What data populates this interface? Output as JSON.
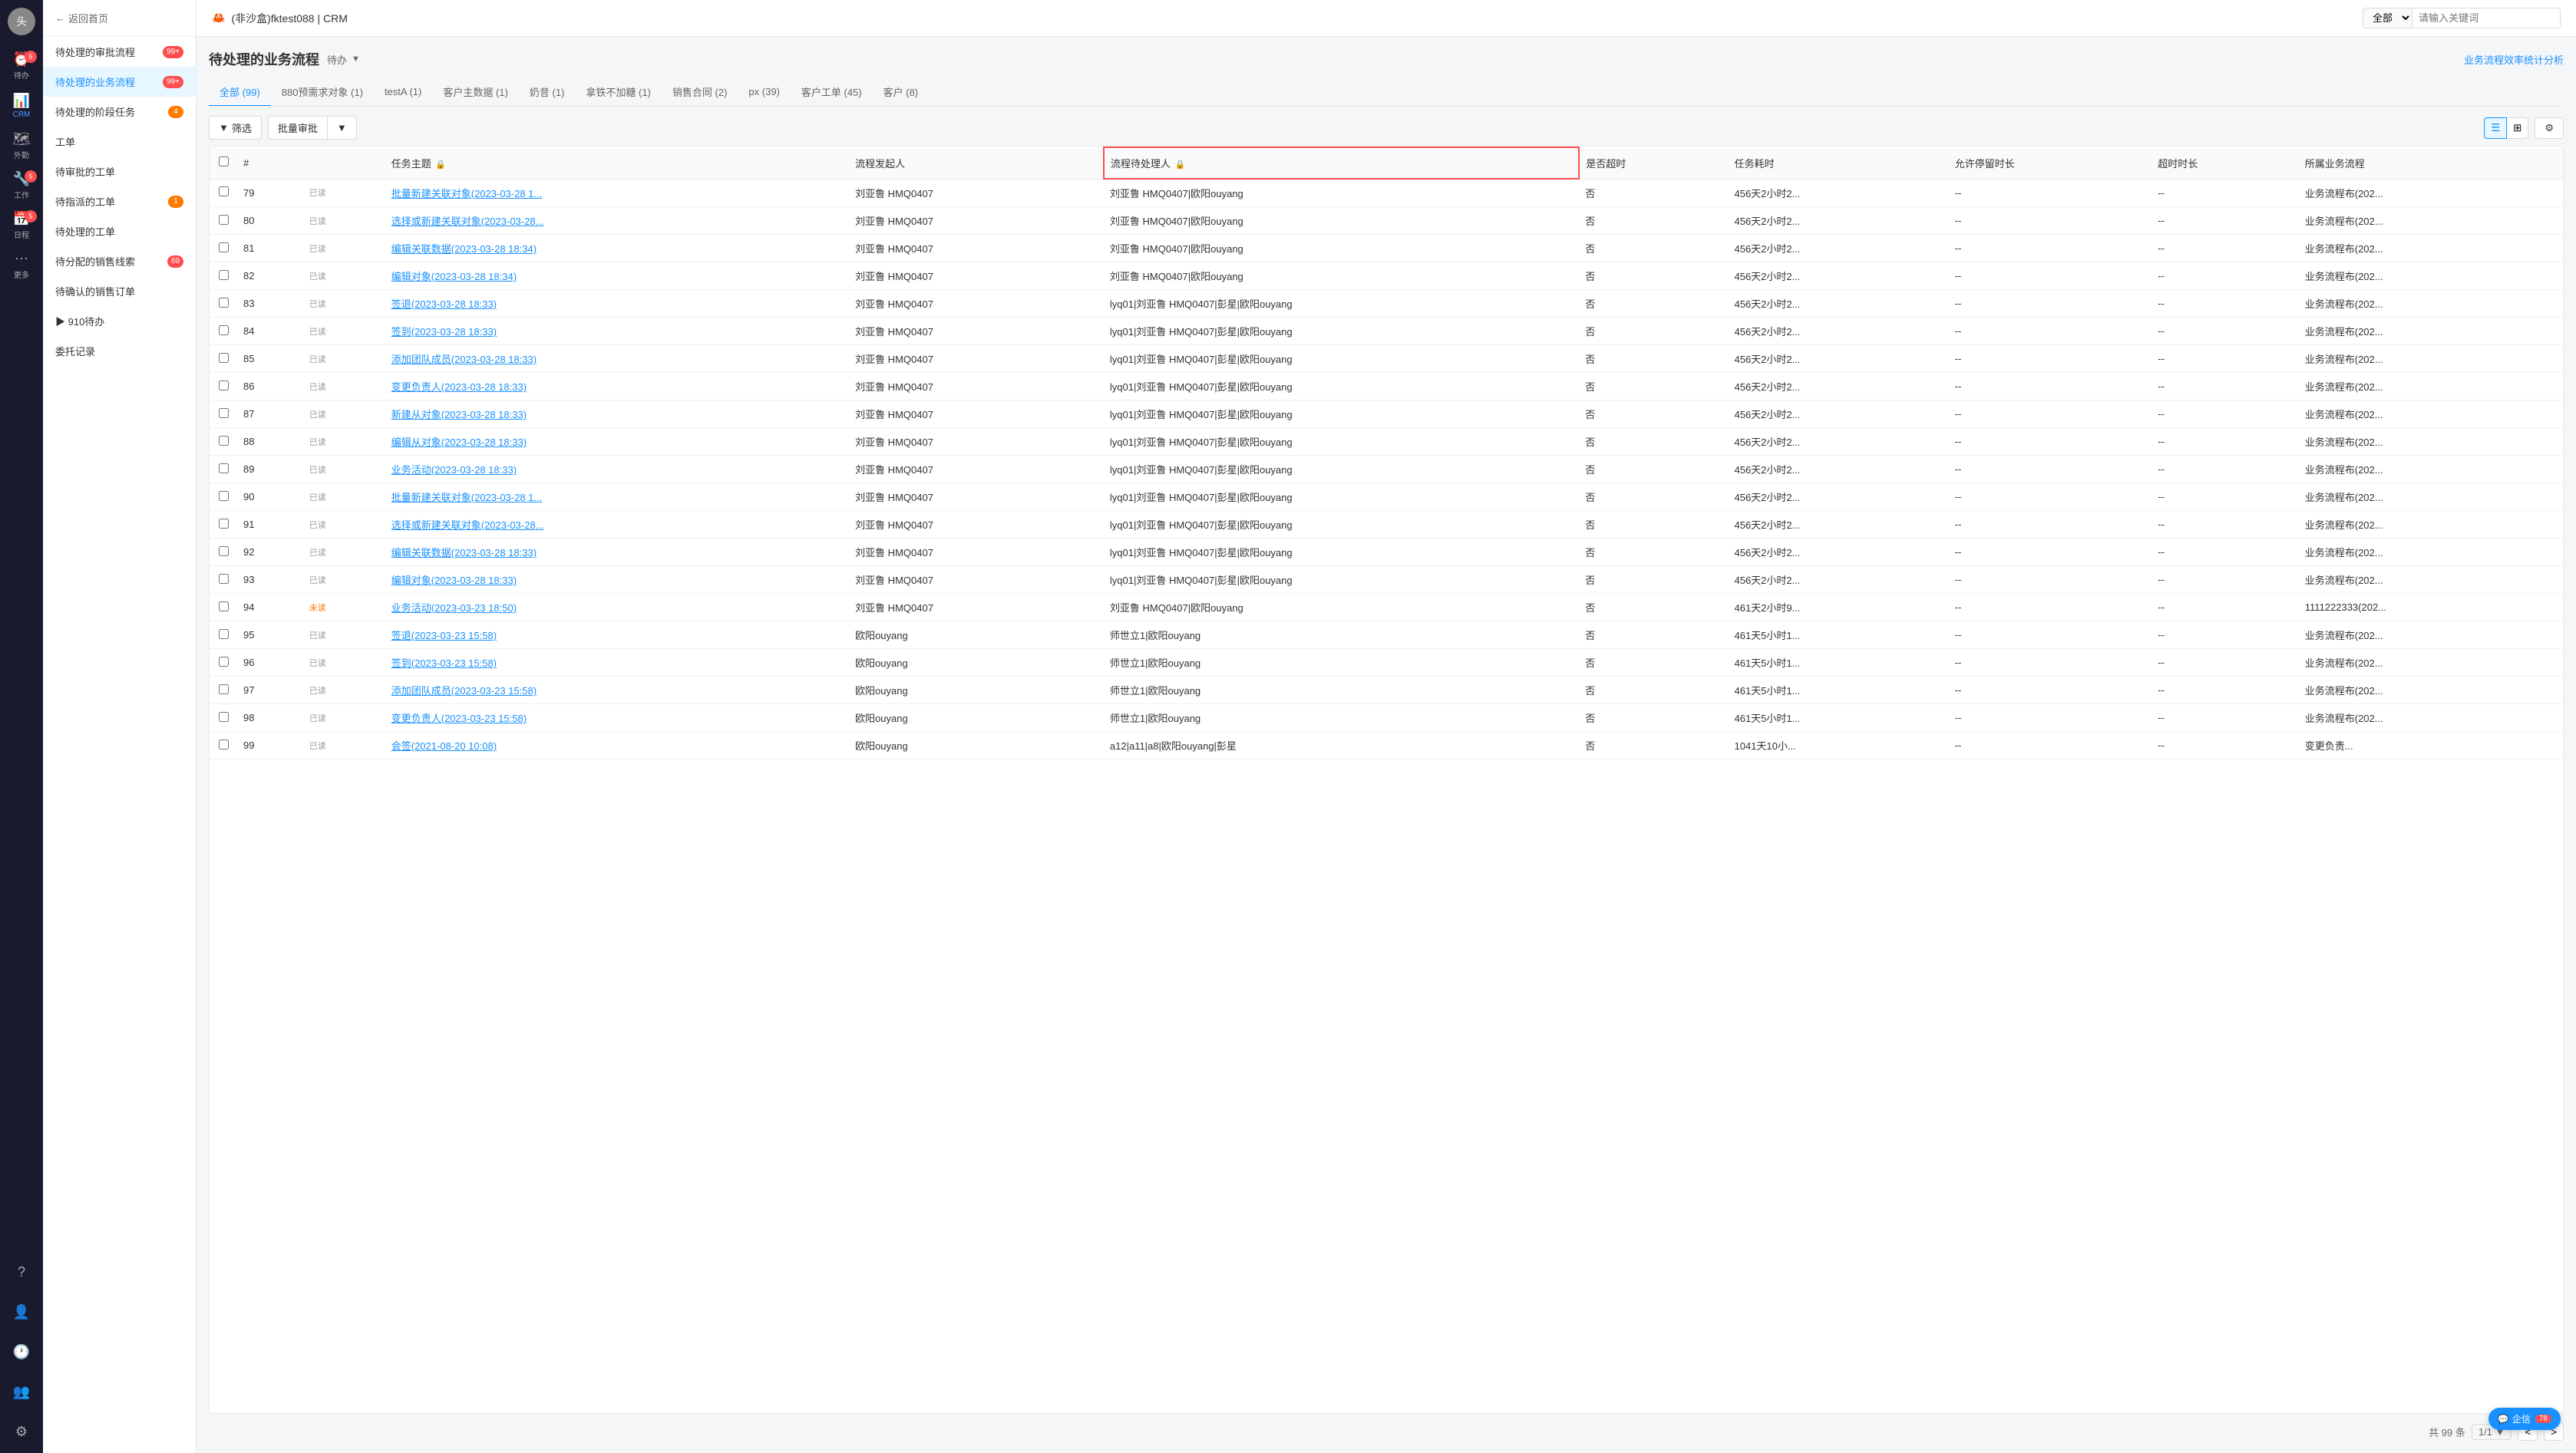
{
  "app": {
    "title": "(非沙盒)fktest088 | CRM",
    "logo": "🦀"
  },
  "topbar": {
    "search_placeholder": "请输入关键词",
    "search_option": "全部",
    "link": "业务流程效率统计分析"
  },
  "nav": {
    "avatar_text": "头",
    "items": [
      {
        "id": "todo",
        "icon": "⏰",
        "label": "待办",
        "badge": "5",
        "active": false
      },
      {
        "id": "crm",
        "icon": "📊",
        "label": "CRM",
        "badge": "",
        "active": true
      },
      {
        "id": "field",
        "icon": "🗺",
        "label": "外勤",
        "badge": "",
        "active": false
      },
      {
        "id": "work",
        "icon": "🔧",
        "label": "工作",
        "badge": "5",
        "active": false
      },
      {
        "id": "schedule",
        "icon": "📅",
        "label": "日程",
        "badge": "5",
        "active": false
      },
      {
        "id": "more",
        "icon": "⋯",
        "label": "更多",
        "badge": "",
        "active": false
      },
      {
        "id": "help",
        "icon": "?",
        "label": "",
        "badge": "",
        "active": false
      },
      {
        "id": "contacts",
        "icon": "👤",
        "label": "",
        "badge": "",
        "active": false
      },
      {
        "id": "history",
        "icon": "🕐",
        "label": "",
        "badge": "",
        "active": false
      },
      {
        "id": "team",
        "icon": "👥",
        "label": "",
        "badge": "",
        "active": false
      },
      {
        "id": "settings",
        "icon": "⚙",
        "label": "",
        "badge": "",
        "active": false
      }
    ]
  },
  "sidebar": {
    "back_label": "返回首页",
    "items": [
      {
        "id": "approval-flow",
        "label": "待处理的审批流程",
        "badge": "99+",
        "badge_type": "red",
        "active": false
      },
      {
        "id": "business-flow",
        "label": "待处理的业务流程",
        "badge": "99+",
        "badge_type": "red",
        "active": true
      },
      {
        "id": "stage-task",
        "label": "待处理的阶段任务",
        "badge": "4",
        "badge_type": "orange",
        "active": false
      },
      {
        "id": "workorder",
        "label": "工单",
        "badge": "",
        "badge_type": "",
        "active": false
      },
      {
        "id": "pending-approval",
        "label": "待审批的工单",
        "badge": "",
        "badge_type": "",
        "active": false
      },
      {
        "id": "assigned-workorder",
        "label": "待指派的工单",
        "badge": "1",
        "badge_type": "orange",
        "active": false
      },
      {
        "id": "pending-workorder",
        "label": "待处理的工单",
        "badge": "",
        "badge_type": "",
        "active": false
      },
      {
        "id": "pending-sales-leads",
        "label": "待分配的销售线索",
        "badge": "69",
        "badge_type": "red",
        "active": false
      },
      {
        "id": "pending-sales-order",
        "label": "待确认的销售订单",
        "badge": "",
        "badge_type": "",
        "active": false
      },
      {
        "id": "group-910",
        "label": "▶ 910待办",
        "badge": "",
        "badge_type": "",
        "active": false
      },
      {
        "id": "delegate",
        "label": "委托记录",
        "badge": "",
        "badge_type": "",
        "active": false
      }
    ]
  },
  "page": {
    "title": "待处理的业务流程",
    "status": "待办",
    "tabs": [
      {
        "id": "all",
        "label": "全部 (99)",
        "active": true
      },
      {
        "id": "880",
        "label": "880预需求对象 (1)",
        "active": false
      },
      {
        "id": "testA",
        "label": "testA (1)",
        "active": false
      },
      {
        "id": "customer-master",
        "label": "客户主数据 (1)",
        "active": false
      },
      {
        "id": "naitang",
        "label": "奶昔 (1)",
        "active": false
      },
      {
        "id": "gatiebutang",
        "label": "拿铁不加糖 (1)",
        "active": false
      },
      {
        "id": "sales-contract",
        "label": "销售合同 (2)",
        "active": false
      },
      {
        "id": "px",
        "label": "px (39)",
        "active": false
      },
      {
        "id": "customer-workorder",
        "label": "客户工单 (45)",
        "active": false
      },
      {
        "id": "customer",
        "label": "客户 (8)",
        "active": false
      }
    ]
  },
  "toolbar": {
    "filter_label": "筛选",
    "batch_label": "批量审批",
    "view_list_label": "列表视图",
    "view_grid_label": "网格视图",
    "settings_label": "设置"
  },
  "table": {
    "columns": [
      {
        "id": "num",
        "label": "#"
      },
      {
        "id": "eye",
        "label": ""
      },
      {
        "id": "subject",
        "label": "任务主题",
        "locked": true
      },
      {
        "id": "initiator",
        "label": "流程发起人"
      },
      {
        "id": "handler",
        "label": "流程待处理人",
        "locked": true,
        "highlighted": true
      },
      {
        "id": "overtime",
        "label": "是否超时"
      },
      {
        "id": "duration",
        "label": "任务耗时"
      },
      {
        "id": "allowed_pause",
        "label": "允许停留时长"
      },
      {
        "id": "overtime_duration",
        "label": "超时时长"
      },
      {
        "id": "flow_name",
        "label": "所属业务流程"
      }
    ],
    "rows": [
      {
        "num": 79,
        "read": "已读",
        "subject": "批量新建关联对象(2023-03-28 1...",
        "initiator": "刘亚鲁 HMQ0407",
        "handler": "刘亚鲁 HMQ0407|欧阳ouyang",
        "overtime": "否",
        "duration": "456天2小时2...",
        "allowed_pause": "--",
        "overtime_duration": "--",
        "flow_name": "业务流程布(202..."
      },
      {
        "num": 80,
        "read": "已读",
        "subject": "选择或新建关联对象(2023-03-28...",
        "initiator": "刘亚鲁 HMQ0407",
        "handler": "刘亚鲁 HMQ0407|欧阳ouyang",
        "overtime": "否",
        "duration": "456天2小时2...",
        "allowed_pause": "--",
        "overtime_duration": "--",
        "flow_name": "业务流程布(202..."
      },
      {
        "num": 81,
        "read": "已读",
        "subject": "编辑关联数据(2023-03-28 18:34)",
        "initiator": "刘亚鲁 HMQ0407",
        "handler": "刘亚鲁 HMQ0407|欧阳ouyang",
        "overtime": "否",
        "duration": "456天2小时2...",
        "allowed_pause": "--",
        "overtime_duration": "--",
        "flow_name": "业务流程布(202..."
      },
      {
        "num": 82,
        "read": "已读",
        "subject": "编辑对象(2023-03-28 18:34)",
        "initiator": "刘亚鲁 HMQ0407",
        "handler": "刘亚鲁 HMQ0407|欧阳ouyang",
        "overtime": "否",
        "duration": "456天2小时2...",
        "allowed_pause": "--",
        "overtime_duration": "--",
        "flow_name": "业务流程布(202..."
      },
      {
        "num": 83,
        "read": "已读",
        "subject": "签退(2023-03-28 18:33)",
        "initiator": "刘亚鲁 HMQ0407",
        "handler": "lyq01|刘亚鲁 HMQ0407|彭星|欧阳ouyang",
        "overtime": "否",
        "duration": "456天2小时2...",
        "allowed_pause": "--",
        "overtime_duration": "--",
        "flow_name": "业务流程布(202..."
      },
      {
        "num": 84,
        "read": "已读",
        "subject": "签到(2023-03-28 18:33)",
        "initiator": "刘亚鲁 HMQ0407",
        "handler": "lyq01|刘亚鲁 HMQ0407|彭星|欧阳ouyang",
        "overtime": "否",
        "duration": "456天2小时2...",
        "allowed_pause": "--",
        "overtime_duration": "--",
        "flow_name": "业务流程布(202..."
      },
      {
        "num": 85,
        "read": "已读",
        "subject": "添加团队成员(2023-03-28 18:33)",
        "initiator": "刘亚鲁 HMQ0407",
        "handler": "lyq01|刘亚鲁 HMQ0407|彭星|欧阳ouyang",
        "overtime": "否",
        "duration": "456天2小时2...",
        "allowed_pause": "--",
        "overtime_duration": "--",
        "flow_name": "业务流程布(202..."
      },
      {
        "num": 86,
        "read": "已读",
        "subject": "变更负责人(2023-03-28 18:33)",
        "initiator": "刘亚鲁 HMQ0407",
        "handler": "lyq01|刘亚鲁 HMQ0407|彭星|欧阳ouyang",
        "overtime": "否",
        "duration": "456天2小时2...",
        "allowed_pause": "--",
        "overtime_duration": "--",
        "flow_name": "业务流程布(202..."
      },
      {
        "num": 87,
        "read": "已读",
        "subject": "新建从对象(2023-03-28 18:33)",
        "initiator": "刘亚鲁 HMQ0407",
        "handler": "lyq01|刘亚鲁 HMQ0407|彭星|欧阳ouyang",
        "overtime": "否",
        "duration": "456天2小时2...",
        "allowed_pause": "--",
        "overtime_duration": "--",
        "flow_name": "业务流程布(202..."
      },
      {
        "num": 88,
        "read": "已读",
        "subject": "编辑从对象(2023-03-28 18:33)",
        "initiator": "刘亚鲁 HMQ0407",
        "handler": "lyq01|刘亚鲁 HMQ0407|彭星|欧阳ouyang",
        "overtime": "否",
        "duration": "456天2小时2...",
        "allowed_pause": "--",
        "overtime_duration": "--",
        "flow_name": "业务流程布(202..."
      },
      {
        "num": 89,
        "read": "已读",
        "subject": "业务活动(2023-03-28 18:33)",
        "initiator": "刘亚鲁 HMQ0407",
        "handler": "lyq01|刘亚鲁 HMQ0407|彭星|欧阳ouyang",
        "overtime": "否",
        "duration": "456天2小时2...",
        "allowed_pause": "--",
        "overtime_duration": "--",
        "flow_name": "业务流程布(202..."
      },
      {
        "num": 90,
        "read": "已读",
        "subject": "批量新建关联对象(2023-03-28 1...",
        "initiator": "刘亚鲁 HMQ0407",
        "handler": "lyq01|刘亚鲁 HMQ0407|彭星|欧阳ouyang",
        "overtime": "否",
        "duration": "456天2小时2...",
        "allowed_pause": "--",
        "overtime_duration": "--",
        "flow_name": "业务流程布(202..."
      },
      {
        "num": 91,
        "read": "已读",
        "subject": "选择或新建关联对象(2023-03-28...",
        "initiator": "刘亚鲁 HMQ0407",
        "handler": "lyq01|刘亚鲁 HMQ0407|彭星|欧阳ouyang",
        "overtime": "否",
        "duration": "456天2小时2...",
        "allowed_pause": "--",
        "overtime_duration": "--",
        "flow_name": "业务流程布(202..."
      },
      {
        "num": 92,
        "read": "已读",
        "subject": "编辑关联数据(2023-03-28 18:33)",
        "initiator": "刘亚鲁 HMQ0407",
        "handler": "lyq01|刘亚鲁 HMQ0407|彭星|欧阳ouyang",
        "overtime": "否",
        "duration": "456天2小时2...",
        "allowed_pause": "--",
        "overtime_duration": "--",
        "flow_name": "业务流程布(202..."
      },
      {
        "num": 93,
        "read": "已读",
        "subject": "编辑对象(2023-03-28 18:33)",
        "initiator": "刘亚鲁 HMQ0407",
        "handler": "lyq01|刘亚鲁 HMQ0407|彭星|欧阳ouyang",
        "overtime": "否",
        "duration": "456天2小时2...",
        "allowed_pause": "--",
        "overtime_duration": "--",
        "flow_name": "业务流程布(202..."
      },
      {
        "num": 94,
        "read": "未读",
        "subject": "业务活动(2023-03-23 18:50)",
        "initiator": "刘亚鲁 HMQ0407",
        "handler": "刘亚鲁 HMQ0407|欧阳ouyang",
        "overtime": "否",
        "duration": "461天2小时9...",
        "allowed_pause": "--",
        "overtime_duration": "--",
        "flow_name": "1111222333(202..."
      },
      {
        "num": 95,
        "read": "已读",
        "subject": "签退(2023-03-23 15:58)",
        "initiator": "欧阳ouyang",
        "handler": "师世立1|欧阳ouyang",
        "overtime": "否",
        "duration": "461天5小时1...",
        "allowed_pause": "--",
        "overtime_duration": "--",
        "flow_name": "业务流程布(202..."
      },
      {
        "num": 96,
        "read": "已读",
        "subject": "签到(2023-03-23 15:58)",
        "initiator": "欧阳ouyang",
        "handler": "师世立1|欧阳ouyang",
        "overtime": "否",
        "duration": "461天5小时1...",
        "allowed_pause": "--",
        "overtime_duration": "--",
        "flow_name": "业务流程布(202..."
      },
      {
        "num": 97,
        "read": "已读",
        "subject": "添加团队成员(2023-03-23 15:58)",
        "initiator": "欧阳ouyang",
        "handler": "师世立1|欧阳ouyang",
        "overtime": "否",
        "duration": "461天5小时1...",
        "allowed_pause": "--",
        "overtime_duration": "--",
        "flow_name": "业务流程布(202..."
      },
      {
        "num": 98,
        "read": "已读",
        "subject": "变更负责人(2023-03-23 15:58)",
        "initiator": "欧阳ouyang",
        "handler": "师世立1|欧阳ouyang",
        "overtime": "否",
        "duration": "461天5小时1...",
        "allowed_pause": "--",
        "overtime_duration": "--",
        "flow_name": "业务流程布(202..."
      },
      {
        "num": 99,
        "read": "已读",
        "subject": "会签(2021-08-20 10:08)",
        "initiator": "欧阳ouyang",
        "handler": "a12|a11|a8|欧阳ouyang|彭星",
        "overtime": "否",
        "duration": "1041天10小...",
        "allowed_pause": "--",
        "overtime_duration": "--",
        "flow_name": "变更负责..."
      }
    ]
  },
  "pagination": {
    "total": "共 99 条",
    "page_info": "1/1 ▼",
    "prev": "<",
    "next": ">"
  },
  "float_button": {
    "label": "企信",
    "badge": "78"
  }
}
